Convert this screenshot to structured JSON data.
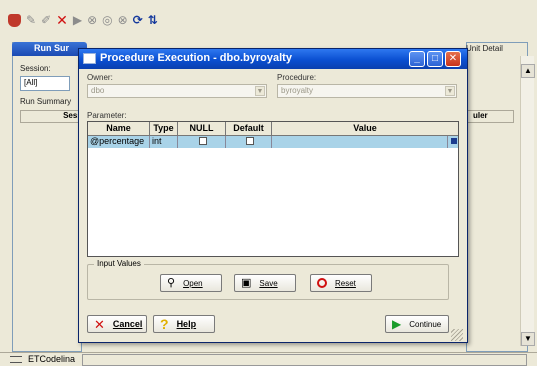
{
  "app": {
    "left_tab": "Run Sur",
    "right_tab": "Unit Detail",
    "session_label": "Session:",
    "session_value": "[All]",
    "run_summary_label": "Run Summary",
    "sess_col": "Sessi",
    "uler_col": "uler",
    "status_text": "ETCodelina"
  },
  "dialog": {
    "title": "Procedure Execution - dbo.byroyalty",
    "owner_label": "Owner:",
    "owner_value": "dbo",
    "procedure_label": "Procedure:",
    "procedure_value": "byroyalty",
    "parameter_label": "Parameter:",
    "columns": [
      "Name",
      "Type",
      "NULL",
      "Default",
      "Value"
    ],
    "rows": [
      {
        "name": "@percentage",
        "type": "int",
        "null": false,
        "default": false,
        "value": ""
      }
    ],
    "input_values_label": "Input Values",
    "open_label": "Open",
    "save_label": "Save",
    "reset_label": "Reset",
    "cancel_label": "Cancel",
    "help_label": "Help",
    "continue_label": "Continue"
  }
}
